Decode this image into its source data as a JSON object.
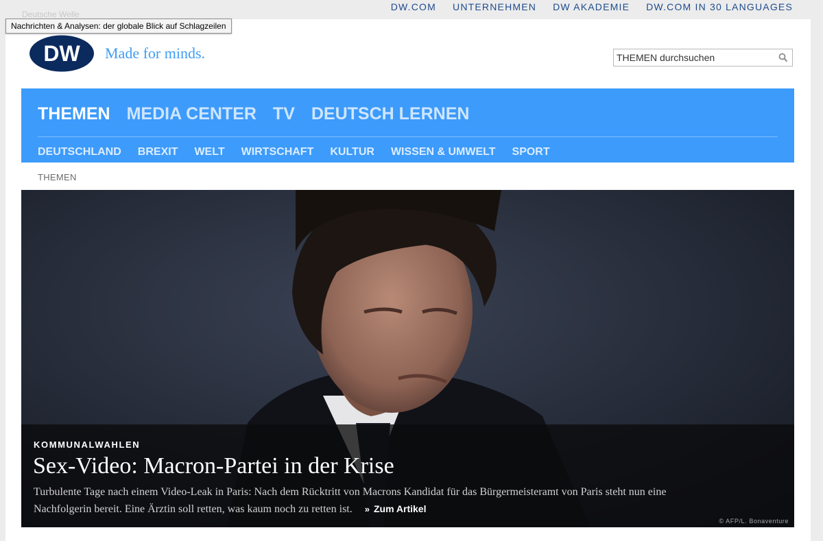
{
  "top_links": [
    "DW.COM",
    "UNTERNEHMEN",
    "DW AKADEMIE",
    "DW.COM IN 30 LANGUAGES"
  ],
  "browser": {
    "faint_text": "Deutsche Welle",
    "tooltip": "Nachrichten & Analysen: der globale Blick auf Schlagzeilen"
  },
  "brand": {
    "logo_text": "DW",
    "tagline": "Made for minds."
  },
  "search": {
    "placeholder": "THEMEN durchsuchen",
    "icon": "search-icon"
  },
  "main_nav": [
    {
      "label": "THEMEN",
      "active": true
    },
    {
      "label": "MEDIA CENTER",
      "active": false
    },
    {
      "label": "TV",
      "active": false
    },
    {
      "label": "DEUTSCH LERNEN",
      "active": false
    }
  ],
  "sub_nav": [
    "DEUTSCHLAND",
    "BREXIT",
    "WELT",
    "WIRTSCHAFT",
    "KULTUR",
    "WISSEN & UMWELT",
    "SPORT"
  ],
  "breadcrumb": "THEMEN",
  "hero": {
    "kicker": "KOMMUNALWAHLEN",
    "headline": "Sex-Video: Macron-Partei in der Krise",
    "teaser": "Turbulente Tage nach einem Video-Leak in Paris: Nach dem Rücktritt von Macrons Kandidat für das Bürgermeisteramt von Paris steht nun eine Nachfolgerin bereit. Eine Ärztin soll retten, was kaum noch zu retten ist.",
    "more_label": "Zum Artikel",
    "credit": "© AFP/L. Bonaventure"
  },
  "colors": {
    "nav_blue": "#3d9bfb",
    "top_link_blue": "#1e4b8e",
    "tagline_blue": "#3f9df4",
    "logo_navy": "#0b2a5e"
  }
}
